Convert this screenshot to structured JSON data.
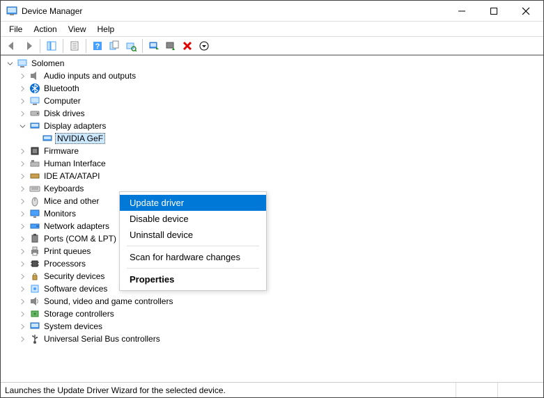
{
  "window": {
    "title": "Device Manager"
  },
  "menu": {
    "file": "File",
    "action": "Action",
    "view": "View",
    "help": "Help"
  },
  "toolbar_icons": {
    "back": "back-icon",
    "forward": "forward-icon",
    "parent": "parent-icon",
    "properties": "properties-icon",
    "help": "help-icon",
    "action1": "refresh-icon",
    "action2": "scan-icon",
    "action3": "monitor-icon",
    "action4": "add-device-icon",
    "uninstall": "uninstall-icon",
    "update": "update-icon"
  },
  "tree": {
    "root": "Solomen",
    "nodes": [
      {
        "label": "Audio inputs and outputs",
        "expanded": false
      },
      {
        "label": "Bluetooth",
        "expanded": false
      },
      {
        "label": "Computer",
        "expanded": false
      },
      {
        "label": "Disk drives",
        "expanded": false
      },
      {
        "label": "Display adapters",
        "expanded": true,
        "children": [
          {
            "label": "NVIDIA GeF",
            "selected": true
          }
        ]
      },
      {
        "label": "Firmware",
        "expanded": false
      },
      {
        "label": "Human Interface",
        "expanded": false,
        "truncated": true
      },
      {
        "label": "IDE ATA/ATAPI",
        "expanded": false,
        "truncated": true
      },
      {
        "label": "Keyboards",
        "expanded": false
      },
      {
        "label": "Mice and other",
        "expanded": false,
        "truncated": true
      },
      {
        "label": "Monitors",
        "expanded": false
      },
      {
        "label": "Network adapters",
        "expanded": false
      },
      {
        "label": "Ports (COM & LPT)",
        "expanded": false
      },
      {
        "label": "Print queues",
        "expanded": false
      },
      {
        "label": "Processors",
        "expanded": false
      },
      {
        "label": "Security devices",
        "expanded": false
      },
      {
        "label": "Software devices",
        "expanded": false
      },
      {
        "label": "Sound, video and game controllers",
        "expanded": false
      },
      {
        "label": "Storage controllers",
        "expanded": false
      },
      {
        "label": "System devices",
        "expanded": false
      },
      {
        "label": "Universal Serial Bus controllers",
        "expanded": false
      }
    ]
  },
  "context": {
    "update": "Update driver",
    "disable": "Disable device",
    "uninstall": "Uninstall device",
    "scan": "Scan for hardware changes",
    "properties": "Properties"
  },
  "status": {
    "text": "Launches the Update Driver Wizard for the selected device."
  }
}
